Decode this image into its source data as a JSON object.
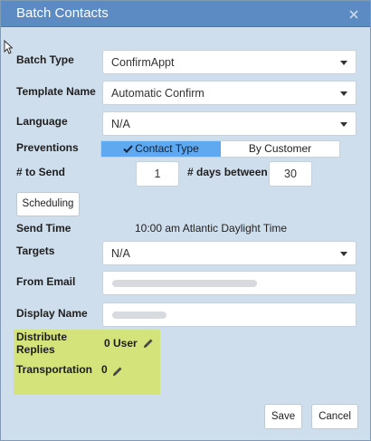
{
  "dialog": {
    "title": "Batch Contacts",
    "close_icon": "close-icon"
  },
  "form": {
    "batch_type": {
      "label": "Batch Type",
      "value": "ConfirmAppt"
    },
    "template_name": {
      "label": "Template Name",
      "value": "Automatic Confirm"
    },
    "language": {
      "label": "Language",
      "value": "N/A"
    },
    "preventions": {
      "label": "Preventions",
      "options": [
        "Contact Type",
        "By Customer"
      ],
      "selected": "Contact Type"
    },
    "to_send": {
      "label": "# to Send",
      "value": "1"
    },
    "days_between": {
      "label": "# days between",
      "value": "30"
    },
    "scheduling_button": "Scheduling",
    "send_time": {
      "label": "Send Time",
      "value": "10:00 am  Atlantic Daylight Time"
    },
    "targets": {
      "label": "Targets",
      "value": "N/A"
    },
    "from_email": {
      "label": "From Email"
    },
    "display_name": {
      "label": "Display Name"
    },
    "distribute_replies": {
      "label_line1": "Distribute",
      "label_line2": "Replies",
      "value": "0 User"
    },
    "transportation": {
      "label": "Transportation",
      "value": "0"
    }
  },
  "footer": {
    "save_label": "Save",
    "cancel_label": "Cancel"
  },
  "colors": {
    "titlebar": "#5b8bc2",
    "dialog_bg": "#cfdeec",
    "segment_active": "#5ea9ef",
    "highlight": "#d4e37a"
  }
}
